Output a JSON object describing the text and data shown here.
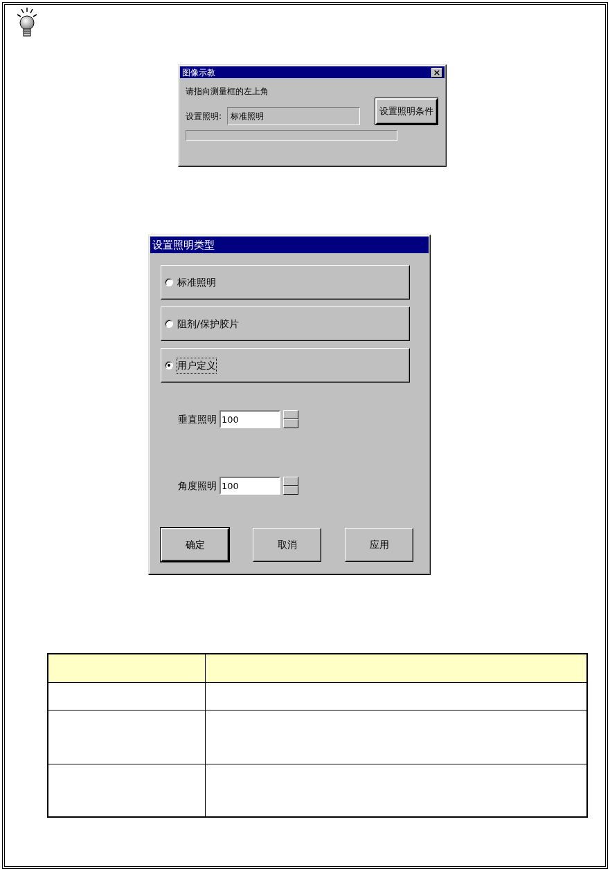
{
  "locate_dialog": {
    "title": "图像示教",
    "close": "×",
    "message": "请指向测量框的左上角",
    "lighting_label": "设置照明:",
    "lighting_value": "标准照明",
    "set_button": "设置照明条件",
    "progress": {
      "level": 0
    }
  },
  "lighting_dialog": {
    "title": "设置照明类型",
    "options": [
      {
        "label": "标准照明",
        "selected": false
      },
      {
        "label": "阻剂/保护胶片",
        "selected": false
      },
      {
        "label": "用户定义",
        "selected": true
      }
    ],
    "spinners": [
      {
        "label": "垂直照明",
        "value": "100"
      },
      {
        "label": "角度照明",
        "value": "100"
      }
    ],
    "buttons": [
      {
        "label": "确定",
        "default": true
      },
      {
        "label": "取消",
        "default": false
      },
      {
        "label": "应用",
        "default": false
      }
    ]
  }
}
